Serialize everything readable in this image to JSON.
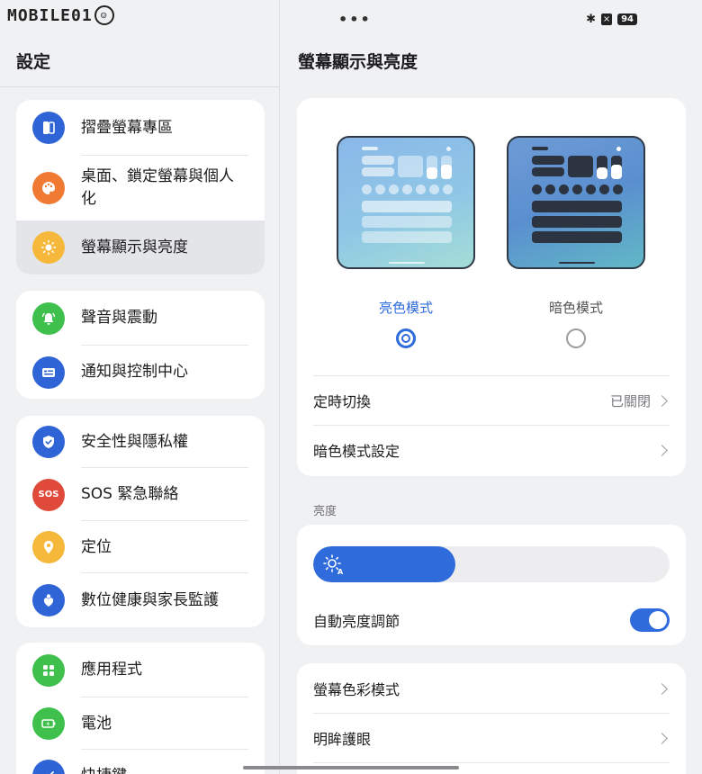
{
  "status": {
    "watermark": "MOBILE01",
    "dots": "•••",
    "battery": "94"
  },
  "left": {
    "title": "設定",
    "groups": [
      [
        {
          "label": "摺疊螢幕專區",
          "color": "#2f64d6"
        },
        {
          "label": "桌面、鎖定螢幕與個人化",
          "color": "#f07a32"
        },
        {
          "label": "螢幕顯示與亮度",
          "color": "#f5b83a"
        }
      ],
      [
        {
          "label": "聲音與震動",
          "color": "#3fbf4c"
        },
        {
          "label": "通知與控制中心",
          "color": "#2f64d6"
        }
      ],
      [
        {
          "label": "安全性與隱私權",
          "color": "#2f64d6"
        },
        {
          "label": "SOS 緊急聯絡",
          "color": "#e04a3a",
          "badge": "SOS"
        },
        {
          "label": "定位",
          "color": "#f5b83a"
        },
        {
          "label": "數位健康與家長監護",
          "color": "#2f64d6"
        }
      ],
      [
        {
          "label": "應用程式",
          "color": "#3fbf4c"
        },
        {
          "label": "電池",
          "color": "#3fbf4c"
        },
        {
          "label": "快捷鍵",
          "color": "#2f64d6"
        }
      ]
    ]
  },
  "right": {
    "title": "螢幕顯示與亮度",
    "light_mode_label": "亮色模式",
    "dark_mode_label": "暗色模式",
    "selected_mode": "light",
    "schedule_label": "定時切換",
    "schedule_value": "已關閉",
    "dark_settings_label": "暗色模式設定",
    "brightness_section": "亮度",
    "brightness_level": 0.4,
    "auto_brightness_label": "自動亮度調節",
    "auto_brightness_on": true,
    "color_mode_label": "螢幕色彩模式",
    "eye_comfort_label": "明眸護眼"
  },
  "accent": "#2f6bdb"
}
